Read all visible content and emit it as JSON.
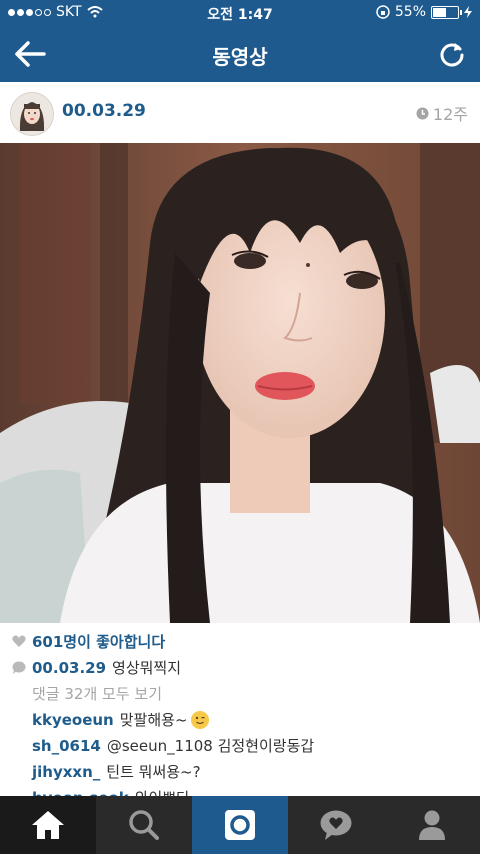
{
  "status_bar": {
    "carrier": "SKT",
    "time": "오전 1:47",
    "battery": "55%",
    "battery_level": 0.55
  },
  "nav": {
    "title": "동영상",
    "back_icon": "arrow-left-icon",
    "refresh_icon": "refresh-icon"
  },
  "post": {
    "username": "00.03.29",
    "time_ago": "12주",
    "likes": "601명이 좋아합니다",
    "caption_user": "00.03.29",
    "caption": "영상뭐찍지",
    "view_all_comments": "댓글 32개 모두 보기",
    "comments": [
      {
        "user": "kkyeoeun",
        "text": "맞팔해용~"
      },
      {
        "user": "sh_0614",
        "text": "@seeun_1108 김정현이랑동갑"
      },
      {
        "user": "jihyxxn_",
        "text": "틴트 뭐써용~?"
      },
      {
        "user": "hyeon.seok",
        "text": "와이쁘다"
      }
    ]
  },
  "tabbar": {
    "items": [
      "home-icon",
      "search-icon",
      "camera-icon",
      "activity-icon",
      "profile-icon"
    ]
  },
  "colors": {
    "brand": "#1e5a8e",
    "link": "#1f5c8b",
    "tabbar": "#2a2a2a"
  }
}
